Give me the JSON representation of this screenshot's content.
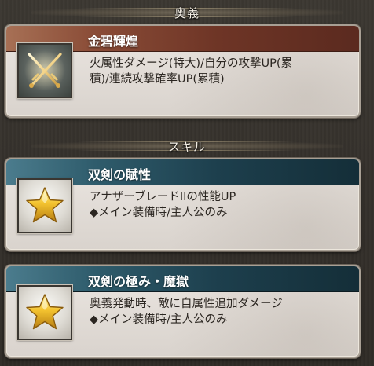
{
  "sections": {
    "ougi_label": "奥義",
    "skill_label": "スキル"
  },
  "ougi": {
    "name": "金碧輝煌",
    "icon": "crossed-swords-icon",
    "lines": [
      "火属性ダメージ(特大)/自分の攻撃UP(累",
      "積)/連続攻撃確率UP(累積)"
    ]
  },
  "skills": [
    {
      "name": "双剣の賦性",
      "icon": "star-icon",
      "lines": [
        "アナザーブレードIIの性能UP",
        "◆メイン装備時/主人公のみ"
      ]
    },
    {
      "name": "双剣の極み・魔獄",
      "icon": "star-icon",
      "lines": [
        "奥義発動時、敵に自属性追加ダメージ",
        "◆メイン装備時/主人公のみ"
      ]
    }
  ],
  "colors": {
    "ougi_title_bar": "#8a4c37",
    "skill_title_bar": "#2f5c6c",
    "card_background": "#e3ded8",
    "page_background": "#34302b",
    "star_gold": "#f2c22e"
  }
}
